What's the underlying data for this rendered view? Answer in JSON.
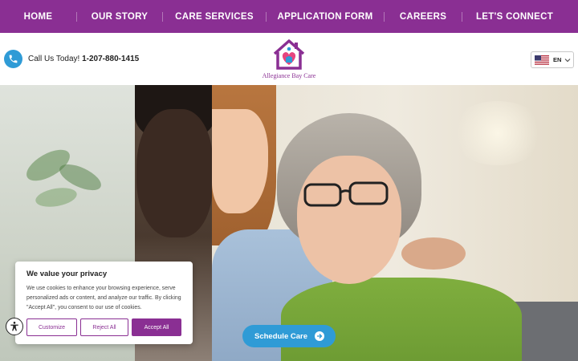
{
  "nav": {
    "items": [
      {
        "label": "HOME",
        "active": true
      },
      {
        "label": "OUR STORY"
      },
      {
        "label": "CARE SERVICES"
      },
      {
        "label": "APPLICATION FORM"
      },
      {
        "label": "CAREERS"
      },
      {
        "label": "LET'S CONNECT"
      }
    ]
  },
  "header": {
    "phone_prefix": "Call Us Today!",
    "phone_number": "1-207-880-1415",
    "phone_icon": "phone-icon",
    "logo_text": "Allegiance Bay Care",
    "language": {
      "code": "EN",
      "flag": "us-flag-icon"
    }
  },
  "cookie": {
    "title": "We value your privacy",
    "body": "We use cookies to enhance your browsing experience, serve personalized ads or content, and analyze our traffic. By clicking \"Accept All\", you consent to our use of cookies.",
    "customize": "Customize",
    "reject": "Reject All",
    "accept": "Accept All"
  },
  "cta": {
    "schedule": "Schedule Care"
  },
  "colors": {
    "brand_purple": "#8a2f93",
    "accent_blue": "#2f9bd6"
  }
}
